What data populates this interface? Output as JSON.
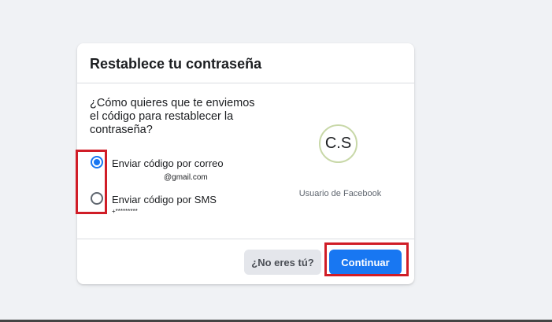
{
  "dialog": {
    "title": "Restablece tu contraseña",
    "question": "¿Cómo quieres que te enviemos el código para restablecer la contraseña?"
  },
  "options": [
    {
      "label": "Enviar código por correo",
      "detail": "@gmail.com",
      "selected": true
    },
    {
      "label": "Enviar código por SMS",
      "detail": "+*********",
      "selected": false
    }
  ],
  "account": {
    "initials": "C.S",
    "name": "Usuario de Facebook"
  },
  "footer": {
    "not_you_label": "¿No eres tú?",
    "continue_label": "Continuar"
  },
  "colors": {
    "accent": "#1877f2",
    "highlight": "#d01d27"
  }
}
